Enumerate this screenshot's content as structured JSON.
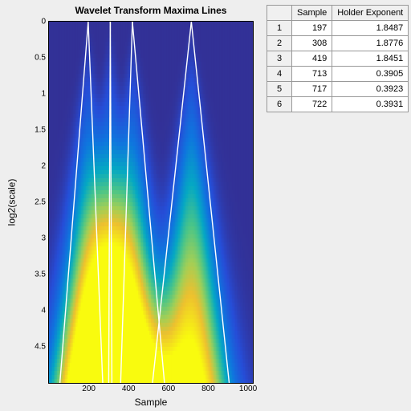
{
  "chart_data": {
    "type": "heatmap",
    "title": "Wavelet Transform Maxima Lines",
    "xlabel": "Sample",
    "ylabel": "log2(scale)",
    "xlim": [
      0,
      1024
    ],
    "ylim_top_to_bottom": [
      0,
      5
    ],
    "xticks": [
      200,
      400,
      600,
      800,
      1000
    ],
    "yticks": [
      0,
      0.5,
      1,
      1.5,
      2,
      2.5,
      3,
      3.5,
      4,
      4.5
    ],
    "energy_ridges_x": [
      197,
      308,
      419,
      715
    ],
    "maxima_lines": [
      {
        "x_top": 197,
        "x_bottom_left": 55,
        "x_bottom_right": 270
      },
      {
        "x_top": 308,
        "x_bottom_left": 300,
        "x_bottom_right": 316
      },
      {
        "x_top": 419,
        "x_bottom_left": 360,
        "x_bottom_right": 580
      },
      {
        "x_top": 715,
        "x_bottom_left": 520,
        "x_bottom_right": 905
      }
    ],
    "colormap": "parula"
  },
  "table": {
    "columns": [
      "Sample",
      "Holder Exponent"
    ],
    "rows": [
      {
        "n": "1",
        "sample": "197",
        "holder": "1.8487"
      },
      {
        "n": "2",
        "sample": "308",
        "holder": "1.8776"
      },
      {
        "n": "3",
        "sample": "419",
        "holder": "1.8451"
      },
      {
        "n": "4",
        "sample": "713",
        "holder": "0.3905"
      },
      {
        "n": "5",
        "sample": "717",
        "holder": "0.3923"
      },
      {
        "n": "6",
        "sample": "722",
        "holder": "0.3931"
      }
    ]
  }
}
